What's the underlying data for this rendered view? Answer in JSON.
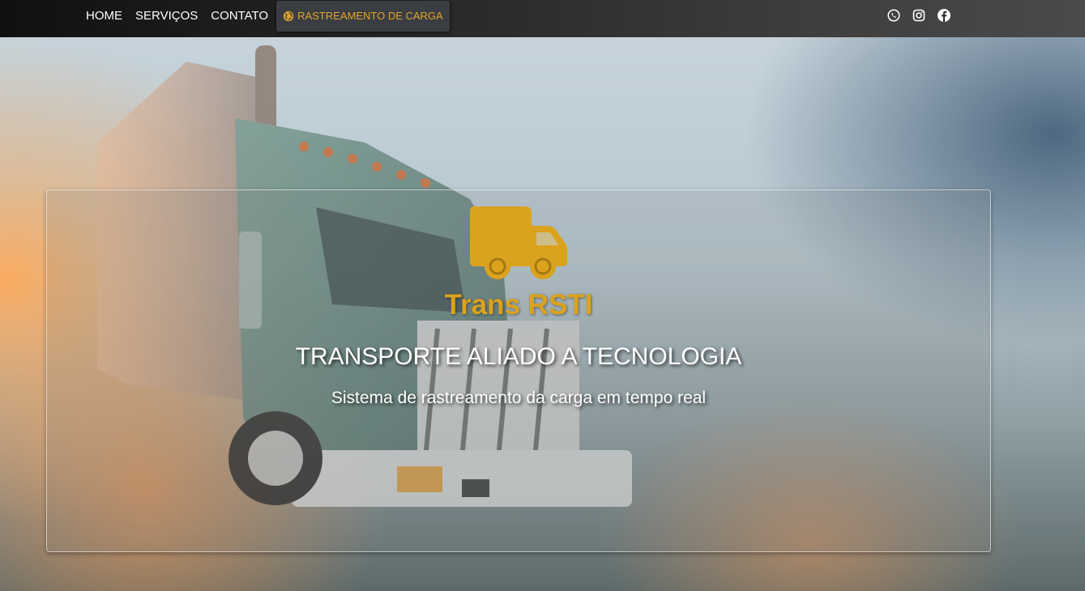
{
  "nav": {
    "items": [
      {
        "label": "HOME"
      },
      {
        "label": "SERVIÇOS"
      },
      {
        "label": "CONTATO"
      }
    ],
    "tracking": {
      "label": "RASTREAMENTO DE CARGA",
      "icon": "globe-icon"
    },
    "active_color": "#e0a62a"
  },
  "social": {
    "icons": [
      "whatsapp-icon",
      "instagram-icon",
      "facebook-icon"
    ]
  },
  "hero": {
    "logo_icon": "truck-icon",
    "brand_name": "Trans RSTI",
    "brand_color": "#dba21e",
    "headline": "TRANSPORTE ALIADO A TECNOLOGIA",
    "subheadline": "Sistema de rastreamento da carga em tempo real"
  }
}
